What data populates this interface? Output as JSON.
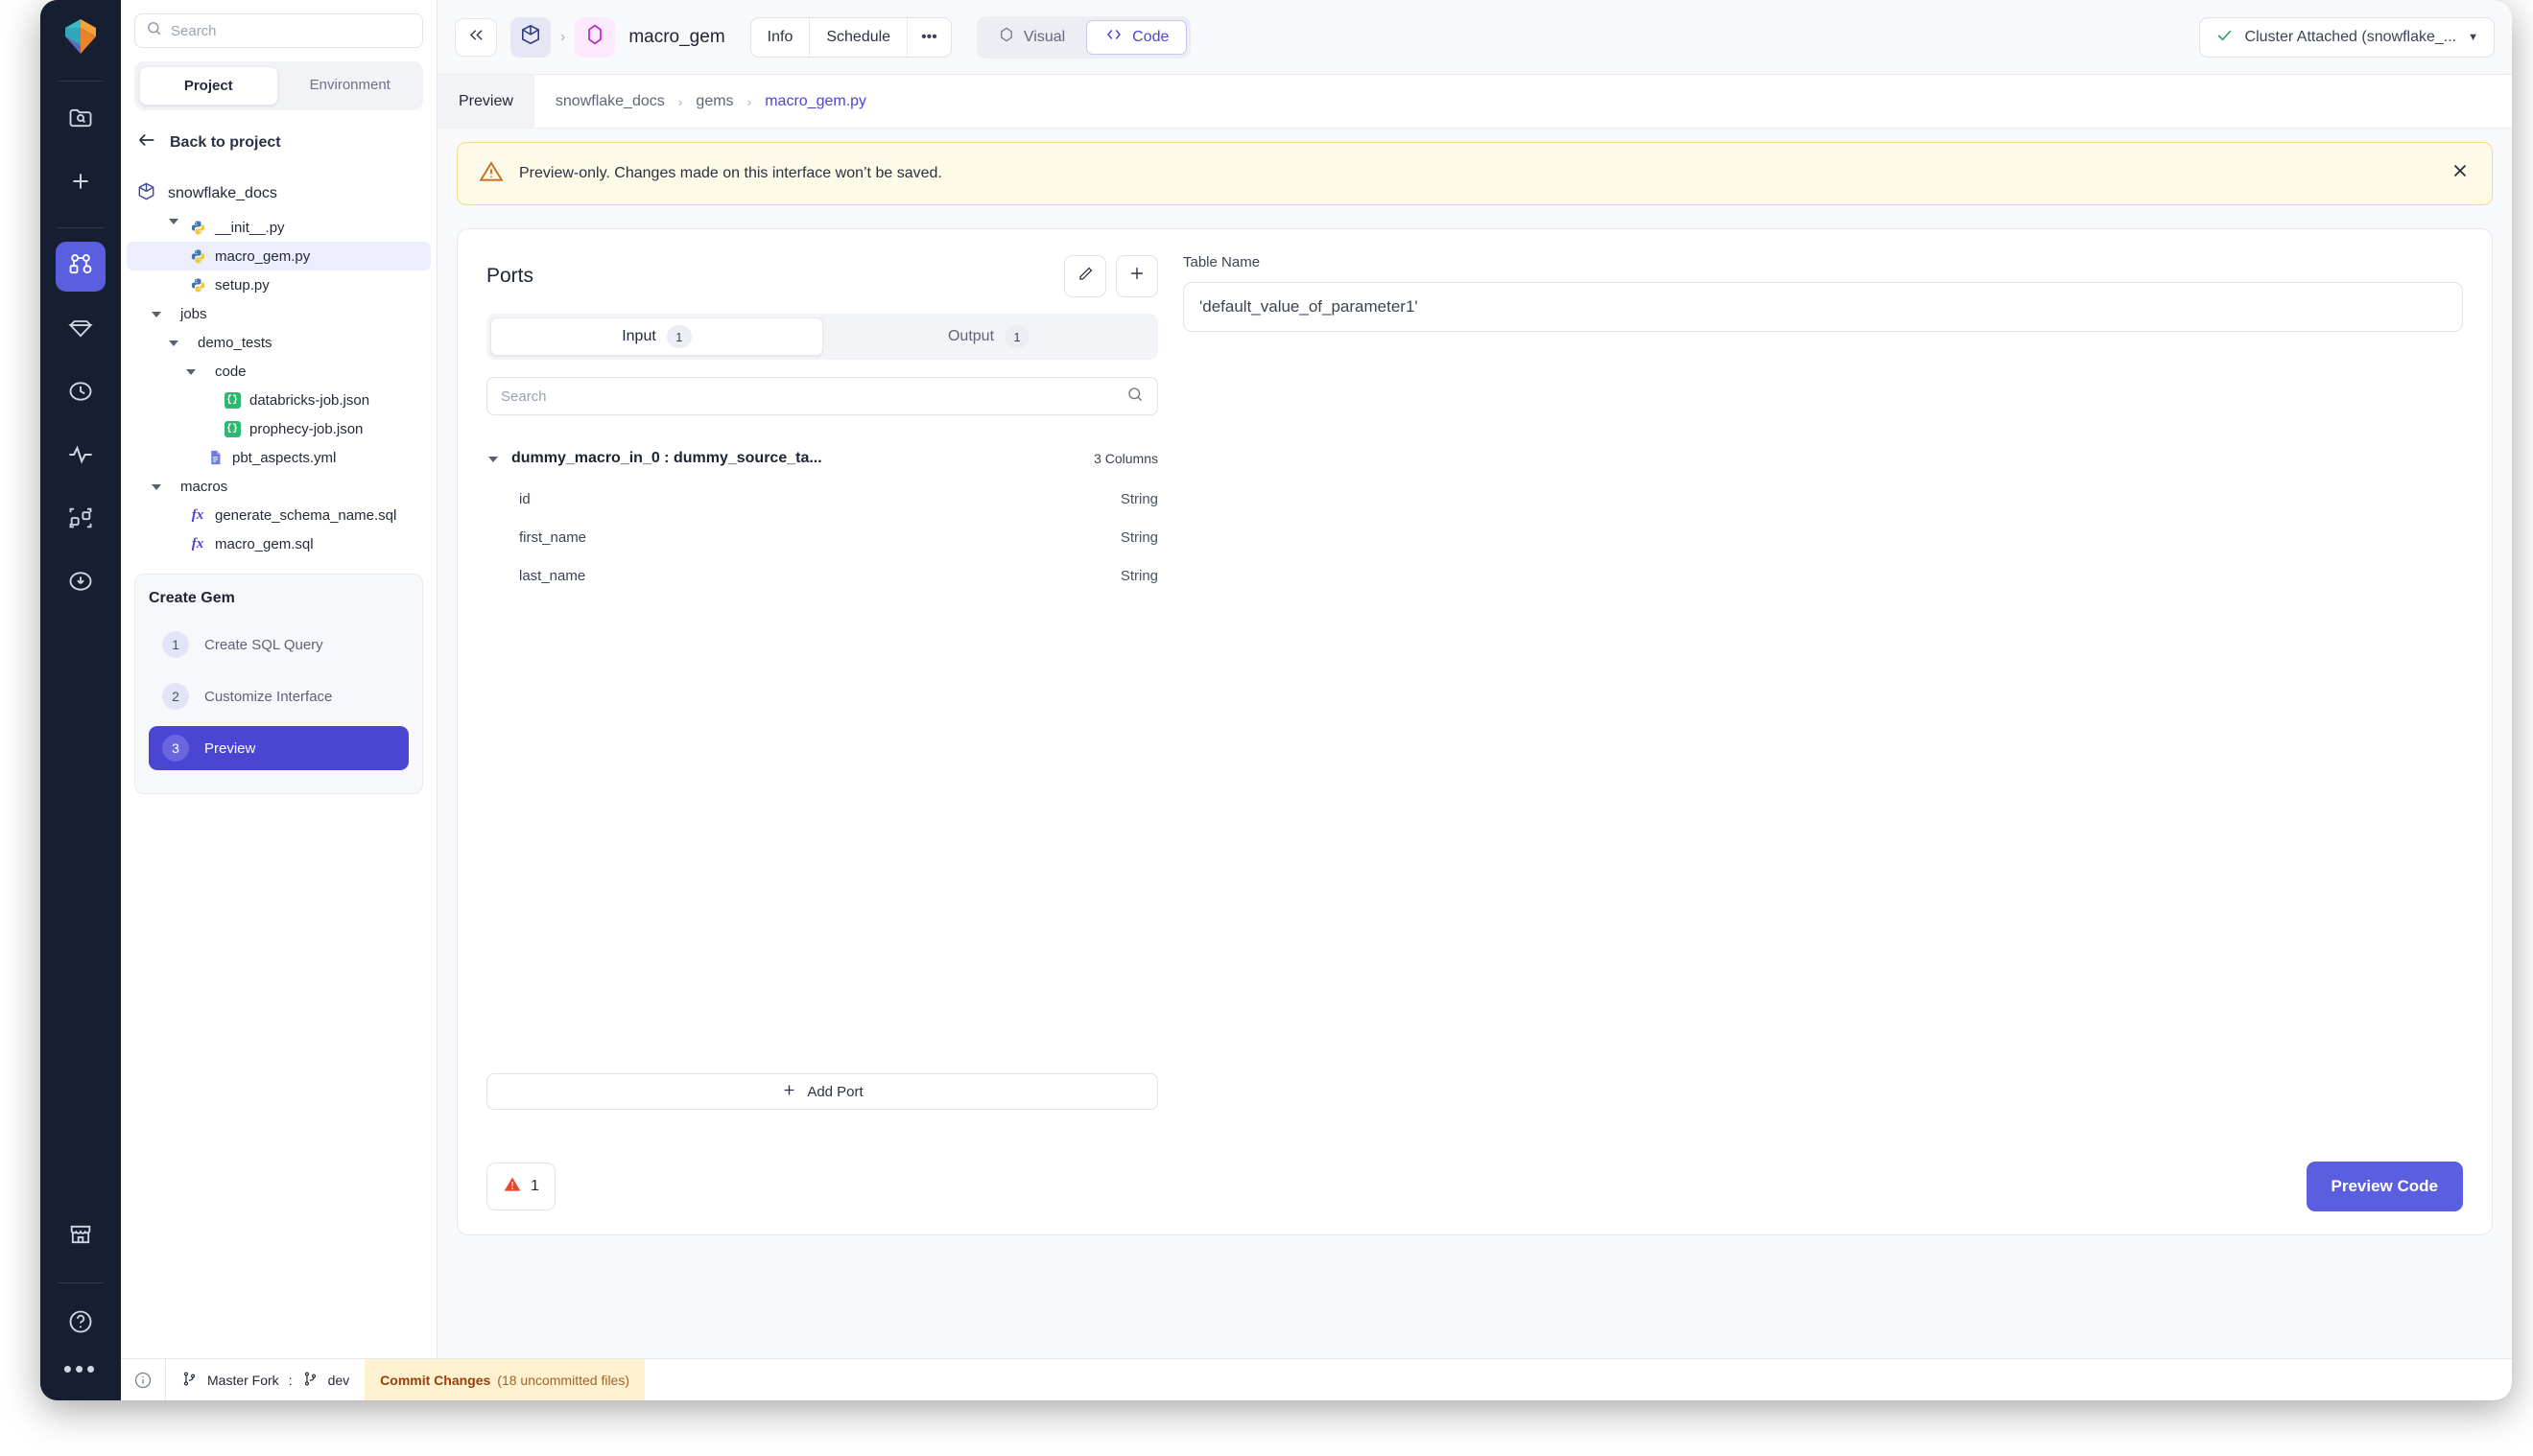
{
  "rail": {
    "logo": "prophecy-logo",
    "items": [
      {
        "name": "folder-search-icon",
        "label": "Search Projects"
      },
      {
        "name": "plus-icon",
        "label": "Create New"
      },
      {
        "name": "pipeline-graph-icon",
        "label": "Projects",
        "active": true
      },
      {
        "name": "gem-icon",
        "label": "Gems"
      },
      {
        "name": "clock-icon",
        "label": "History"
      },
      {
        "name": "activity-pulse-icon",
        "label": "Monitoring"
      },
      {
        "name": "lineage-icon",
        "label": "Lineage"
      },
      {
        "name": "download-circle-icon",
        "label": "Downloads"
      }
    ],
    "bottom": [
      {
        "name": "store-icon",
        "label": "Marketplace"
      },
      {
        "name": "help-circle-icon",
        "label": "Help"
      },
      {
        "name": "more-dots-icon",
        "label": "More"
      }
    ]
  },
  "sidebar": {
    "search": {
      "placeholder": "Search",
      "value": ""
    },
    "tabs": [
      {
        "label": "Project",
        "active": true
      },
      {
        "label": "Environment",
        "active": false
      }
    ],
    "back_label": "Back to project",
    "project_name": "snowflake_docs",
    "tree": [
      {
        "label": "__init__.py",
        "icon": "python-file-icon",
        "indent": 2,
        "selected": false,
        "caret": "clip"
      },
      {
        "label": "macro_gem.py",
        "icon": "python-file-icon",
        "indent": 2,
        "selected": true,
        "caret": "none"
      },
      {
        "label": "setup.py",
        "icon": "python-file-icon",
        "indent": 2,
        "selected": false,
        "caret": "none"
      },
      {
        "label": "jobs",
        "icon": "none",
        "indent": 1,
        "selected": false,
        "caret": "down"
      },
      {
        "label": "demo_tests",
        "icon": "none",
        "indent": 2,
        "selected": false,
        "caret": "down"
      },
      {
        "label": "code",
        "icon": "none",
        "indent": 3,
        "selected": false,
        "caret": "down"
      },
      {
        "label": "databricks-job.json",
        "icon": "json-file-icon",
        "indent": 4,
        "selected": false,
        "caret": "none"
      },
      {
        "label": "prophecy-job.json",
        "icon": "json-file-icon",
        "indent": 4,
        "selected": false,
        "caret": "none"
      },
      {
        "label": "pbt_aspects.yml",
        "icon": "yaml-file-icon",
        "indent": 3,
        "selected": false,
        "caret": "none"
      },
      {
        "label": "macros",
        "icon": "none",
        "indent": 1,
        "selected": false,
        "caret": "down"
      },
      {
        "label": "generate_schema_name.sql",
        "icon": "sql-macro-icon",
        "indent": 2,
        "selected": false,
        "caret": "none"
      },
      {
        "label": "macro_gem.sql",
        "icon": "sql-macro-icon",
        "indent": 2,
        "selected": false,
        "caret": "none"
      }
    ],
    "create_gem": {
      "title": "Create Gem",
      "steps": [
        {
          "num": "1",
          "label": "Create SQL Query",
          "active": false
        },
        {
          "num": "2",
          "label": "Customize Interface",
          "active": false
        },
        {
          "num": "3",
          "label": "Preview",
          "active": true
        }
      ]
    }
  },
  "topbar": {
    "collapse_icon": "chevrons-left-icon",
    "project_icon": "cube-icon",
    "gem_icon": "gem-hexagon-icon",
    "gem_name": "macro_gem",
    "tabs": [
      {
        "label": "Info"
      },
      {
        "label": "Schedule"
      },
      {
        "label": "•••"
      }
    ],
    "view_toggle": [
      {
        "label": "Visual",
        "icon": "gem-outline-icon",
        "active": false
      },
      {
        "label": "Code",
        "icon": "code-brackets-icon",
        "active": true
      }
    ],
    "cluster": {
      "label": "Cluster Attached (snowflake_...",
      "status_icon": "check-icon",
      "status_color": "#35a35f",
      "caret_icon": "chevron-down-icon"
    }
  },
  "breadcrumb": {
    "active_label": "Preview",
    "path": [
      "snowflake_docs",
      "gems",
      "macro_gem.py"
    ]
  },
  "banner": {
    "icon": "warning-triangle-icon",
    "message": "Preview-only. Changes made on this interface won’t be saved.",
    "close_icon": "close-icon",
    "bg_color": "#fefae8",
    "border_color": "#f3d98a"
  },
  "ports": {
    "title": "Ports",
    "edit_icon": "pencil-icon",
    "add_icon": "plus-icon",
    "tabs": [
      {
        "label": "Input",
        "count": "1",
        "active": true
      },
      {
        "label": "Output",
        "count": "1",
        "active": false
      }
    ],
    "search_placeholder": "Search",
    "search_value": "",
    "table": {
      "name": "dummy_macro_in_0 : dummy_source_ta...",
      "columns_count": "3 Columns",
      "columns": [
        {
          "name": "id",
          "type": "String"
        },
        {
          "name": "first_name",
          "type": "String"
        },
        {
          "name": "last_name",
          "type": "String"
        }
      ]
    },
    "add_port_label": "Add Port"
  },
  "table_name_field": {
    "label": "Table Name",
    "value": "'default_value_of_parameter1'"
  },
  "footer": {
    "error_icon": "error-triangle-icon",
    "error_count": "1",
    "primary_label": "Preview Code",
    "primary_color": "#5a5fe0"
  },
  "statusbar": {
    "info_icon": "info-circle-icon",
    "branch_icon": "git-branch-icon",
    "fork_label": "Master Fork",
    "separator": ":",
    "branch_label": "dev",
    "commit_label": "Commit Changes",
    "commit_sub": "(18 uncommitted files)"
  }
}
